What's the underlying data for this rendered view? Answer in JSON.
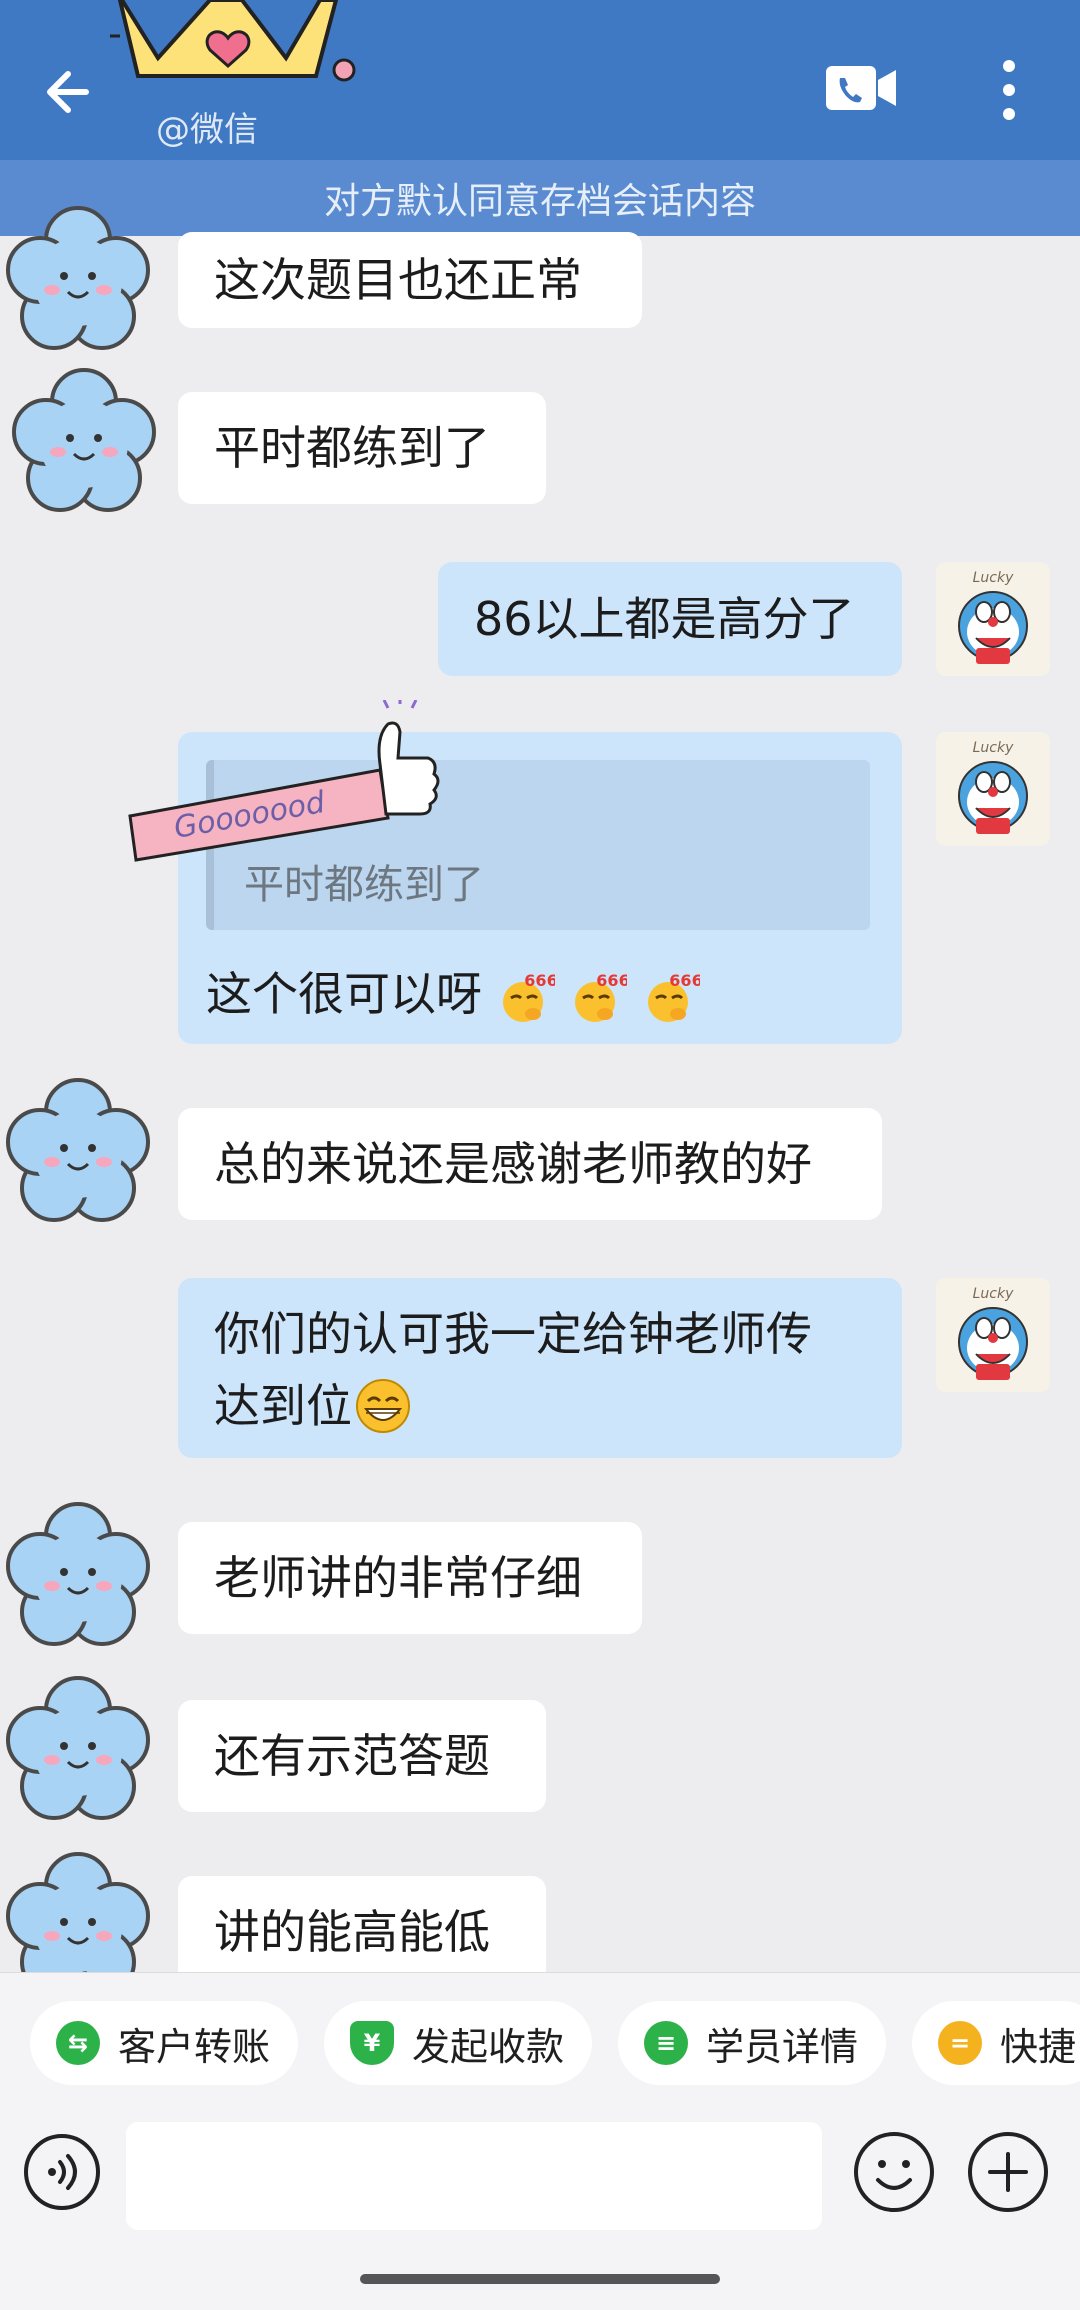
{
  "header": {
    "watermark": "@微信",
    "notice": "对方默认同意存档会话内容"
  },
  "messages": [
    {
      "side": "left",
      "text": "这次题目也还正常"
    },
    {
      "side": "left",
      "text": "平时都练到了"
    },
    {
      "side": "right",
      "text": "86以上都是高分了"
    },
    {
      "side": "right",
      "quote": "平时都练到了",
      "text": "这个很可以呀"
    },
    {
      "side": "left",
      "text": "总的来说还是感谢老师教的好"
    },
    {
      "side": "right",
      "text_line1": "你们的认可我一定给钟老师传",
      "text_line2": "达到位"
    },
    {
      "side": "left",
      "text": "老师讲的非常仔细"
    },
    {
      "side": "left",
      "text": "还有示范答题"
    },
    {
      "side": "left",
      "text": "讲的能高能低"
    }
  ],
  "sticker": {
    "good_text": "Gooooood",
    "lucky_text": "Lucky",
    "emoji_666": "666"
  },
  "quick_actions": [
    {
      "label": "客户转账",
      "icon": "transfer-icon",
      "color": "#2db24a"
    },
    {
      "label": "发起收款",
      "icon": "yuan-shield-icon",
      "color": "#2db24a"
    },
    {
      "label": "学员详情",
      "icon": "student-icon",
      "color": "#2db24a"
    },
    {
      "label": "快捷",
      "icon": "quick-reply-icon",
      "color": "#f5b21f"
    }
  ],
  "input": {
    "placeholder": ""
  }
}
